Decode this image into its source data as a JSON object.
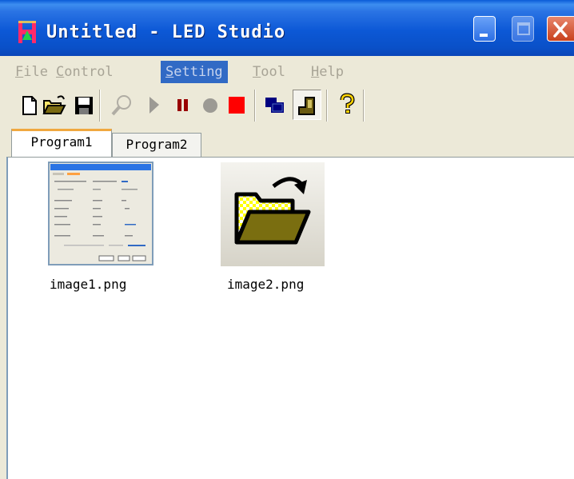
{
  "window": {
    "title": "Untitled - LED Studio",
    "icon": "led-studio-icon"
  },
  "title_buttons": {
    "minimize": "minimize-icon",
    "maximize": "maximize-icon",
    "close": "close-icon"
  },
  "menu": [
    {
      "label": "File",
      "underline": "F",
      "rest": "ile"
    },
    {
      "label": "Control",
      "underline": "C",
      "rest": "ontrol"
    },
    {
      "label": "Setting",
      "underline": "S",
      "rest": "etting",
      "active": true
    },
    {
      "label": "Tool",
      "underline": "T",
      "rest": "ool"
    },
    {
      "label": "Help",
      "underline": "H",
      "rest": "elp"
    }
  ],
  "toolbar": {
    "new": "new-document-icon",
    "open": "open-folder-icon",
    "save": "save-disk-icon",
    "find": "magnifier-icon",
    "play": "play-icon",
    "pause": "pause-icon",
    "record": "record-icon",
    "stop": "stop-icon",
    "window_mode": "window-mode-icon",
    "pressed_tool": "boot-icon",
    "help": "help-icon"
  },
  "tabs": [
    {
      "label": "Program1",
      "selected": true
    },
    {
      "label": "Program2",
      "selected": false
    }
  ],
  "files": [
    {
      "name": "image1.png",
      "icon": "screenshot-thumbnail"
    },
    {
      "name": "image2.png",
      "icon": "open-folder-thumbnail"
    }
  ],
  "colors": {
    "titlebar": "#0c58d6",
    "menu_highlight": "#316ac5",
    "disabled_text": "#a8a496",
    "tab_accent": "#f0a840",
    "pause": "#990000",
    "stop": "#ff0000",
    "play_disabled": "#9c9a94",
    "help": "#ffd400"
  }
}
